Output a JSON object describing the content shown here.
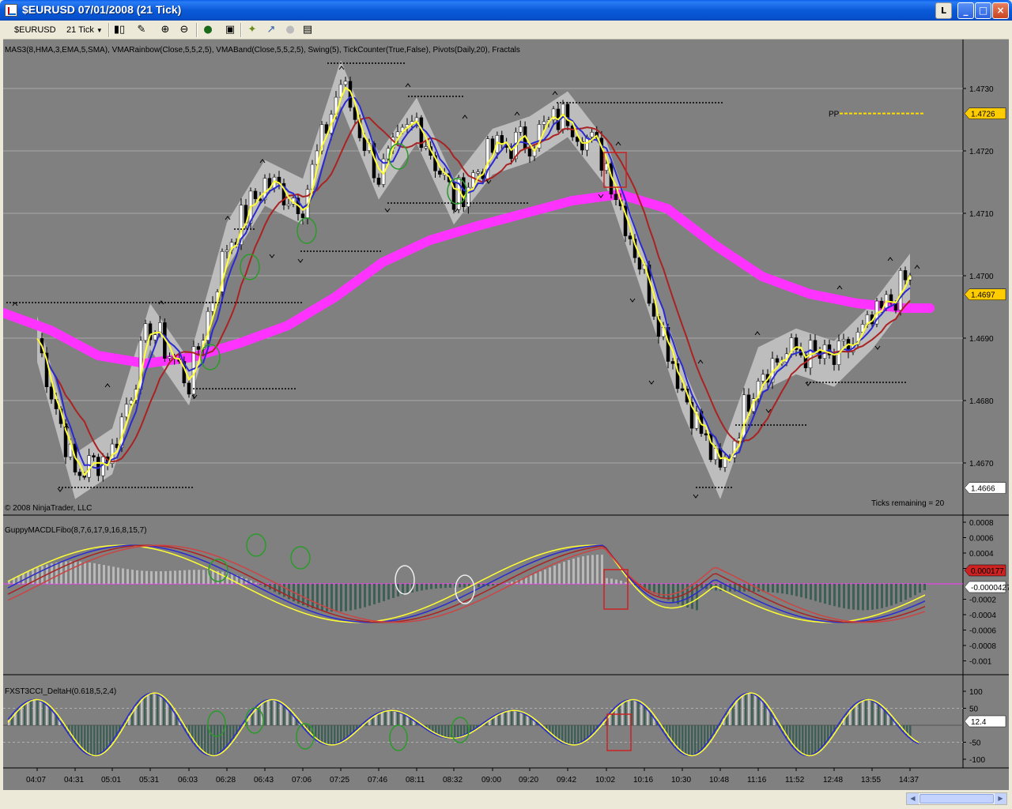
{
  "window": {
    "title": "$EURUSD  07/01/2008  (21 Tick)",
    "l_button": "L",
    "minimize": "_",
    "maximize": "□",
    "close": "×"
  },
  "toolbar": {
    "instrument": "$EURUSD",
    "interval": "21 Tick",
    "icons": [
      "candlestick-icon",
      "draw-pencil-icon",
      "zoom-in-icon",
      "zoom-out-icon",
      "globe-icon",
      "properties-icon",
      "strategy-icon",
      "indicator-icon",
      "disabled-circle-icon",
      "data-box-icon"
    ]
  },
  "chart": {
    "indicator_label": "MAS3(8,HMA,3,EMA,5,SMA), VMARainbow(Close,5,5,2,5), VMABand(Close,5,5,2,5), Swing(5), TickCounter(True,False), Pivots(Daily,20), Fractals",
    "copyright": "© 2008 NinjaTrader, LLC",
    "ticks_remaining": "Ticks remaining = 20",
    "pivot_label": "PP",
    "price_ticks": [
      "1.4730",
      "1.4720",
      "1.4710",
      "1.4700",
      "1.4690",
      "1.4680",
      "1.4670"
    ],
    "price_boxes": [
      "1.4726",
      "1.4697",
      "1.4666"
    ],
    "macd_label": "GuppyMACDLFibo(8,7,6,17,9,16,8,15,7)",
    "macd_ticks": [
      "0.0008",
      "0.0006",
      "0.0004",
      "0.0002",
      "-0.0002",
      "-0.0004",
      "-0.0006",
      "-0.0008",
      "-0.001"
    ],
    "macd_boxes": [
      "0.000177",
      "-0.0000427"
    ],
    "cci_label": "FXST3CCI_DeltaH(0.618,5,2,4)",
    "cci_ticks": [
      "100",
      "50",
      "-50",
      "-100"
    ],
    "cci_box": "12.4",
    "time_ticks": [
      "04:07",
      "04:31",
      "05:01",
      "05:31",
      "06:03",
      "06:28",
      "06:43",
      "07:06",
      "07:25",
      "07:46",
      "08:11",
      "08:32",
      "09:00",
      "09:20",
      "09:42",
      "10:02",
      "10:16",
      "10:30",
      "10:48",
      "11:16",
      "11:52",
      "12:48",
      "13:55",
      "14:37"
    ]
  },
  "colors": {
    "background": "#808080",
    "yellow_line": "#ffff33",
    "blue_line": "#2a2ad0",
    "red_line": "#aa2222",
    "magenta_band": "#ff33ff",
    "pivot": "#ffdd00"
  },
  "chart_data": {
    "type": "line",
    "title": "$EURUSD 07/01/2008 (21 Tick)",
    "xlabel": "",
    "ylabel": "",
    "x": [
      "04:07",
      "04:31",
      "05:01",
      "05:31",
      "06:03",
      "06:28",
      "06:43",
      "07:06",
      "07:25",
      "07:46",
      "08:11",
      "08:32",
      "09:00",
      "09:20",
      "09:42",
      "10:02",
      "10:16",
      "10:30",
      "10:48",
      "11:16",
      "11:52",
      "12:48",
      "13:55",
      "14:37"
    ],
    "series": [
      {
        "name": "",
        "values": [
          1.469,
          1.4668,
          1.4672,
          1.4692,
          1.4683,
          1.4705,
          1.4715,
          1.4712,
          1.4731,
          1.4716,
          1.4725,
          1.4712,
          1.472,
          1.4722,
          1.4726,
          1.4718,
          1.47,
          1.4682,
          1.4668,
          1.4685,
          1.4688,
          1.4686,
          1.4692,
          1.47
        ]
      }
    ],
    "ylim": [
      1.466,
      1.4738
    ],
    "pivot_pp": 1.4726,
    "last_price": 1.4697,
    "low_marker": 1.4666
  }
}
